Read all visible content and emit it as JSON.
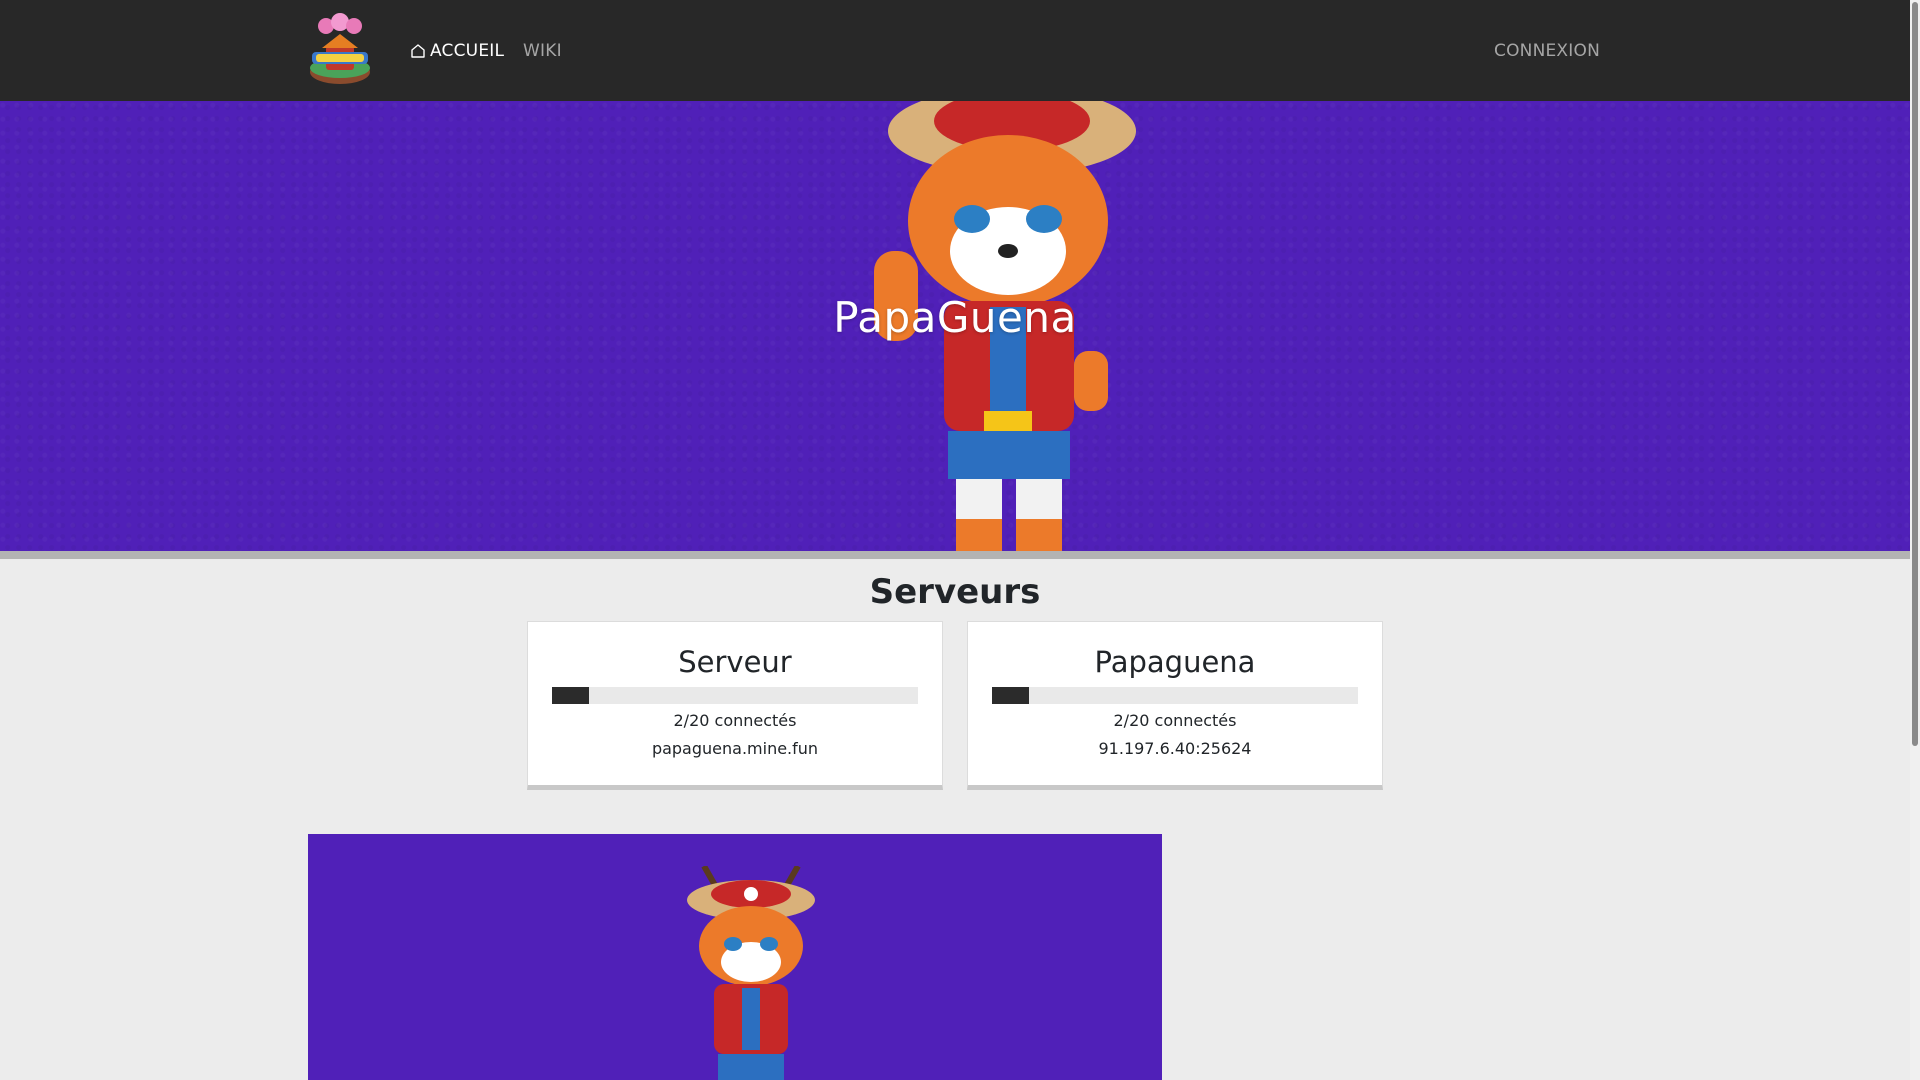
{
  "nav": {
    "home_label": "ACCUEIL",
    "wiki_label": "WIKI",
    "login_label": "CONNEXION"
  },
  "hero": {
    "title": "PapaGuena"
  },
  "servers": {
    "section_title": "Serveurs",
    "items": [
      {
        "name": "Serveur",
        "players_online": 2,
        "players_max": 20,
        "count_text": "2/20 connectés",
        "address": "papaguena.mine.fun"
      },
      {
        "name": "Papaguena",
        "players_online": 2,
        "players_max": 20,
        "count_text": "2/20 connectés",
        "address": "91.197.6.40:25624"
      }
    ]
  },
  "colors": {
    "navbar": "#282828",
    "hero_bg": "#5020b8",
    "page_bg": "#ececec",
    "progress_fill": "#2b2b2b"
  }
}
